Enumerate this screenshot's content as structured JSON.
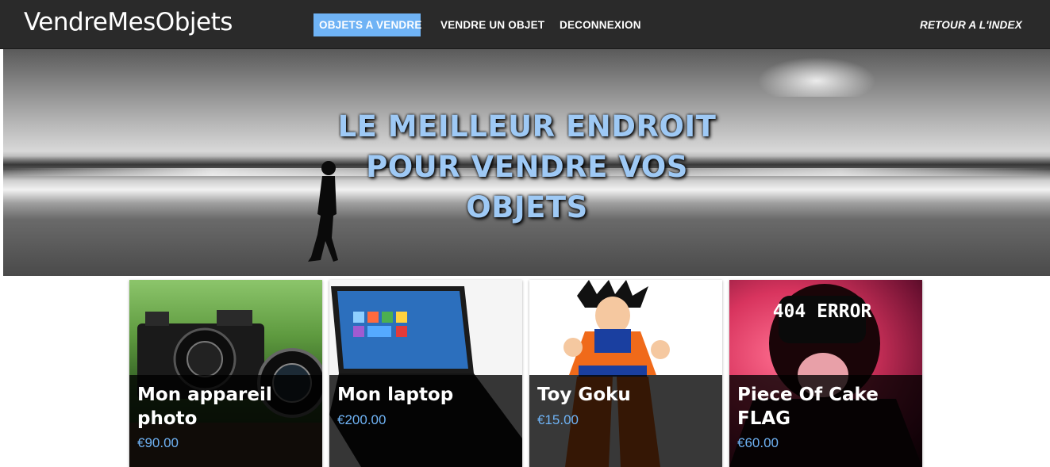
{
  "navbar": {
    "brand": "VendreMesObjets",
    "items": [
      {
        "label": "OBJETS A VENDRE",
        "active": true
      },
      {
        "label": "VENDRE UN OBJET",
        "active": false
      },
      {
        "label": "DECONNEXION",
        "active": false
      }
    ],
    "right_link": "RETOUR A L'INDEX"
  },
  "hero": {
    "headline": "LE MEILLEUR ENDROIT POUR VENDRE VOS OBJETS"
  },
  "products": [
    {
      "title": "Mon appareil photo",
      "price": "€90.00",
      "image": "camera-image"
    },
    {
      "title": "Mon laptop",
      "price": "€200.00",
      "image": "laptop-image"
    },
    {
      "title": "Toy Goku",
      "price": "€15.00",
      "image": "goku-image"
    },
    {
      "title": "Piece Of Cake FLAG",
      "price": "€60.00",
      "image": "404-error-image",
      "image_text": "404 ERROR"
    }
  ],
  "colors": {
    "navbar_bg": "#2a2a2a",
    "accent": "#6fb3f5",
    "hero_text": "#9ec9f5",
    "overlay": "rgba(0,0,0,0.78)"
  }
}
